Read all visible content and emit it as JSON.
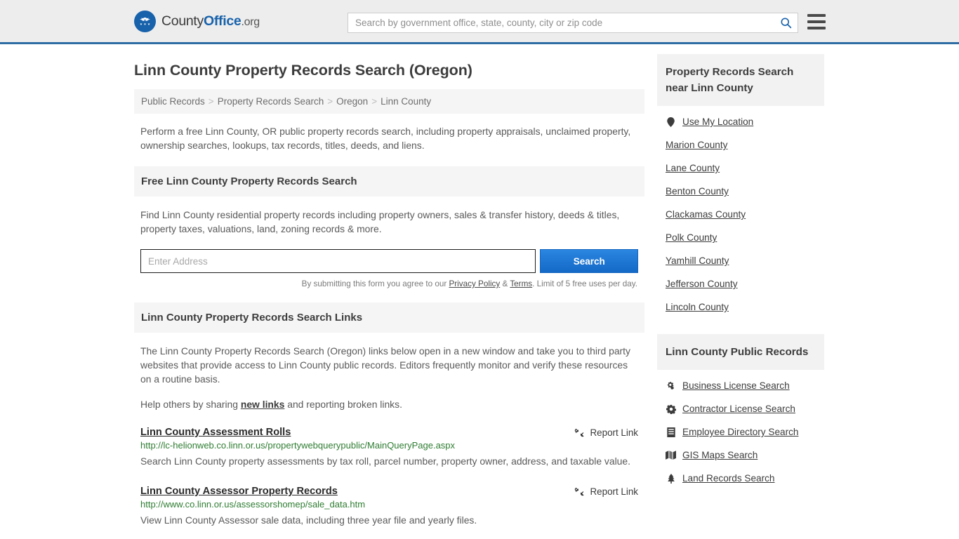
{
  "header": {
    "logo": {
      "icon": "eagle-seal-icon",
      "part1": "County",
      "part2": "Office",
      "part3": ".org"
    },
    "search": {
      "placeholder": "Search by government office, state, county, city or zip code",
      "value": "",
      "icon": "search-icon"
    },
    "menu_icon": "hamburger-menu-icon",
    "accent_color": "#2e6da4"
  },
  "main": {
    "title": "Linn County Property Records Search (Oregon)",
    "breadcrumb": [
      "Public Records",
      "Property Records Search",
      "Oregon",
      "Linn County"
    ],
    "breadcrumb_separator": ">",
    "intro": "Perform a free Linn County, OR public property records search, including property appraisals, unclaimed property, ownership searches, lookups, tax records, titles, deeds, and liens.",
    "search_panel": {
      "heading": "Free Linn County Property Records Search",
      "description": "Find Linn County residential property records including property owners, sales & transfer history, deeds & titles, property taxes, valuations, land, zoning records & more.",
      "input_placeholder": "Enter Address",
      "input_value": "",
      "submit_label": "Search",
      "note_prefix": "By submitting this form you agree to our ",
      "note_privacy": "Privacy Policy",
      "note_amp": " & ",
      "note_terms": "Terms",
      "note_suffix": ". Limit of 5 free uses per day."
    },
    "links_panel": {
      "heading": "Linn County Property Records Search Links",
      "paragraph": "The Linn County Property Records Search (Oregon) links below open in a new window and take you to third party websites that provide access to Linn County public records. Editors frequently monitor and verify these resources on a routine basis.",
      "help_prefix": "Help others by sharing ",
      "help_link": "new links",
      "help_suffix": " and reporting broken links.",
      "report_label": "Report Link",
      "report_icon": "broken-link-icon",
      "items": [
        {
          "title": "Linn County Assessment Rolls",
          "url": "http://lc-helionweb.co.linn.or.us/propertywebquerypublic/MainQueryPage.aspx",
          "description": "Search Linn County property assessments by tax roll, parcel number, property owner, address, and taxable value."
        },
        {
          "title": "Linn County Assessor Property Records",
          "url": "http://www.co.linn.or.us/assessorshomep/sale_data.htm",
          "description": "View Linn County Assessor sale data, including three year file and yearly files."
        }
      ]
    }
  },
  "sidebar": {
    "nearby": {
      "heading": "Property Records Search near Linn County",
      "items": [
        {
          "label": "Use My Location",
          "icon": "map-pin-icon"
        },
        {
          "label": "Marion County",
          "icon": ""
        },
        {
          "label": "Lane County",
          "icon": ""
        },
        {
          "label": "Benton County",
          "icon": ""
        },
        {
          "label": "Clackamas County",
          "icon": ""
        },
        {
          "label": "Polk County",
          "icon": ""
        },
        {
          "label": "Yamhill County",
          "icon": ""
        },
        {
          "label": "Jefferson County",
          "icon": ""
        },
        {
          "label": "Lincoln County",
          "icon": ""
        }
      ]
    },
    "public_records": {
      "heading": "Linn County Public Records",
      "items": [
        {
          "label": "Business License Search",
          "icon": "cogs-icon"
        },
        {
          "label": "Contractor License Search",
          "icon": "gear-icon"
        },
        {
          "label": "Employee Directory Search",
          "icon": "book-icon"
        },
        {
          "label": "GIS Maps Search",
          "icon": "map-icon"
        },
        {
          "label": "Land Records Search",
          "icon": "tree-icon"
        }
      ]
    }
  }
}
